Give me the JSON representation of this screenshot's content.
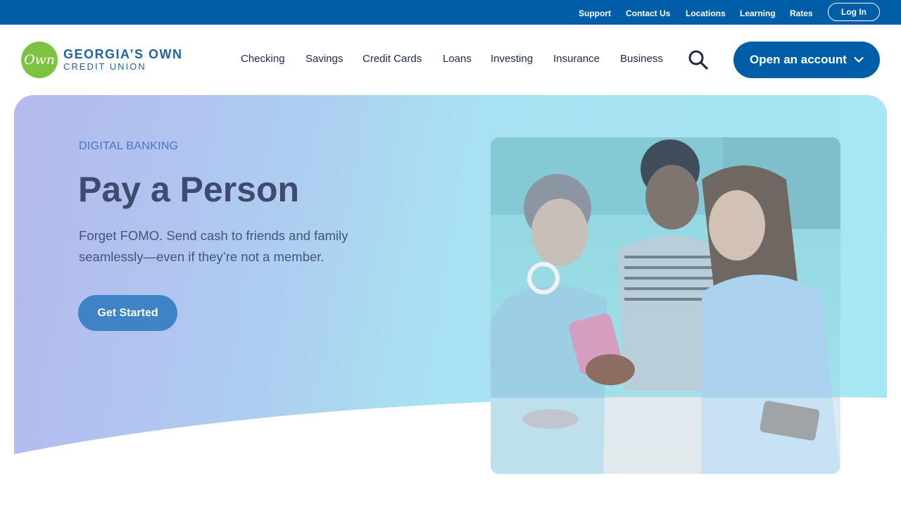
{
  "utility_nav": {
    "links": [
      "Support",
      "Contact Us",
      "Locations",
      "Learning",
      "Rates"
    ],
    "login_label": "Log In"
  },
  "brand": {
    "mark": "Own",
    "name_line1": "GEORGIA’S OWN",
    "name_line2": "CREDIT UNION"
  },
  "main_nav": {
    "items": [
      "Checking",
      "Savings",
      "Credit Cards",
      "Loans",
      "Investing",
      "Insurance",
      "Business"
    ],
    "search_icon": "search-icon",
    "cta_label": "Open an account"
  },
  "hero": {
    "eyebrow": "DIGITAL BANKING",
    "title": "Pay a Person",
    "body": "Forget FOMO. Send cash to friends and family seamlessly—even if they’re not a member.",
    "button_label": "Get Started"
  },
  "colors": {
    "brand_blue": "#005DA8",
    "brand_green": "#7DC242",
    "hero_button": "#3D83C6",
    "eyebrow": "#4A72C8",
    "title_text": "#3E4A6E"
  }
}
